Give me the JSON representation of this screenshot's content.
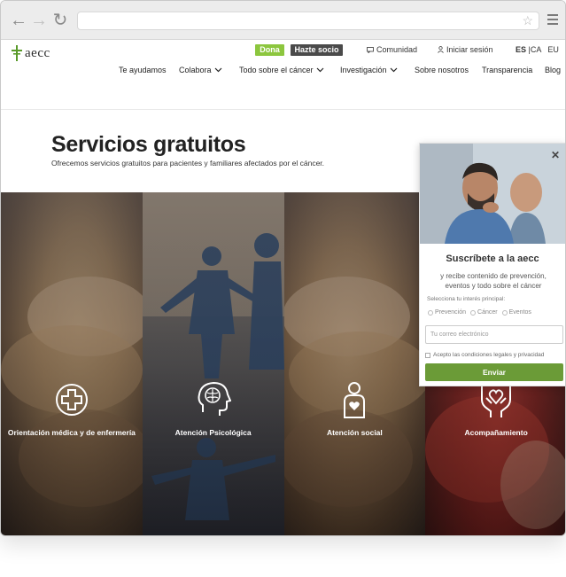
{
  "browser": {
    "back_icon": "←",
    "forward_icon": "→",
    "reload_icon": "↻",
    "star_icon": "☆"
  },
  "header": {
    "logo_text": "aecc",
    "top": {
      "dona": "Dona",
      "socio": "Hazte socio",
      "comunidad": "Comunidad",
      "login": "Iniciar sesión"
    },
    "langs": {
      "es": "ES",
      "ca": "CA",
      "eu": "EU",
      "sep": "|"
    },
    "nav": [
      {
        "label": "Te ayudamos"
      },
      {
        "label": "Colabora",
        "dropdown": true
      },
      {
        "label": "Todo sobre el cáncer",
        "dropdown": true
      },
      {
        "label": "Investigación",
        "dropdown": true
      },
      {
        "label": "Sobre nosotros"
      },
      {
        "label": "Transparencia"
      },
      {
        "label": "Blog"
      }
    ]
  },
  "main": {
    "title": "Servicios gratuitos",
    "subtitle": "Ofrecemos servicios gratuitos para pacientes y familiares afectados por el cáncer."
  },
  "services": [
    {
      "label": "Orientación médica y de enfermería",
      "icon": "medical-cross-icon"
    },
    {
      "label": "Atención Psicológica",
      "icon": "brain-head-icon"
    },
    {
      "label": "Atención social",
      "icon": "person-heart-icon"
    },
    {
      "label": "Acompañamiento",
      "icon": "hands-heart-icon"
    }
  ],
  "popup": {
    "close": "✕",
    "title": "Suscríbete a la aecc",
    "desc": "y recibe contenido de prevención, eventos y todo sobre el cáncer",
    "select_label": "Selecciona tu interés principal:",
    "options": [
      "Prevención",
      "Cáncer",
      "Eventos"
    ],
    "email_placeholder": "Tu correo electrónico",
    "accept": "Acepto las condiciones legales y privacidad",
    "send": "Enviar"
  },
  "colors": {
    "green": "#8cc63e",
    "dark": "#4a4a4a",
    "button_green": "#6b9b37"
  }
}
